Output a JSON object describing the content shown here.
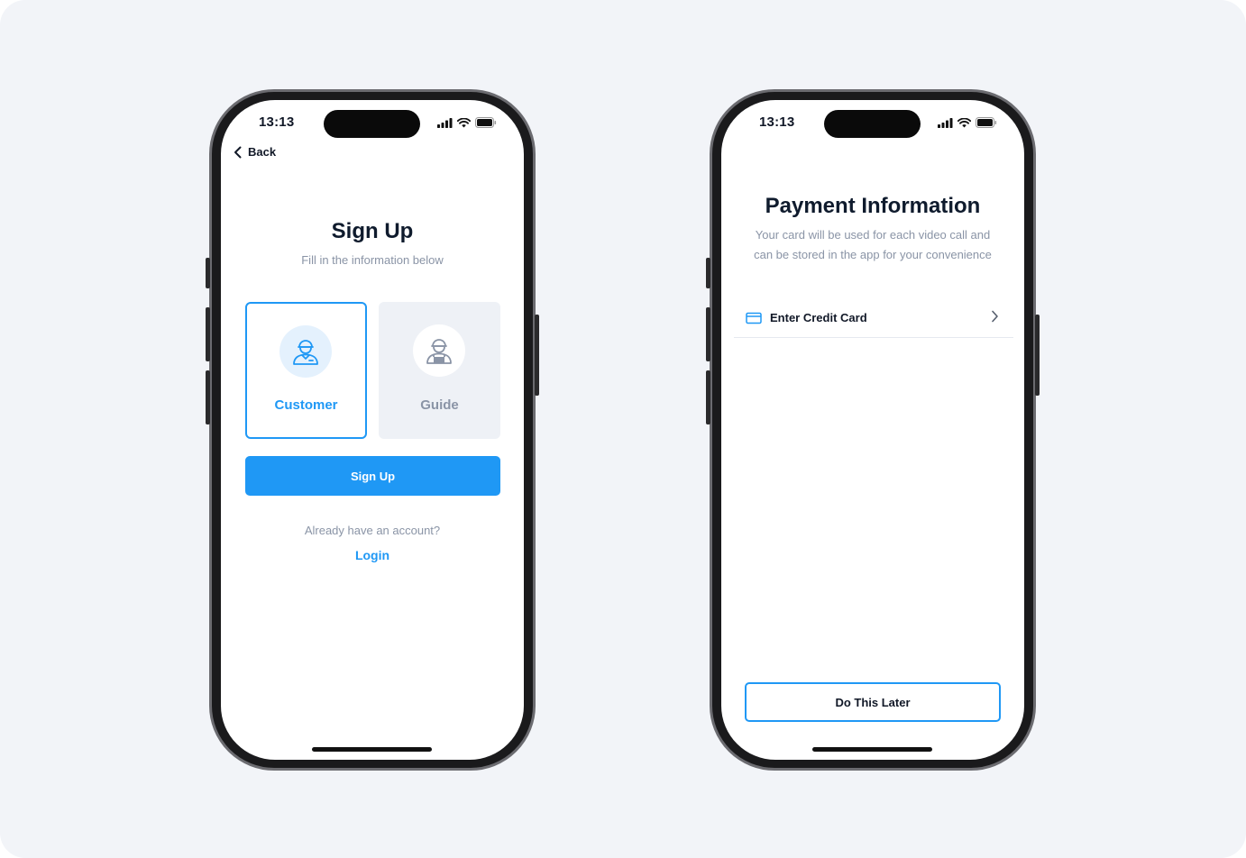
{
  "colors": {
    "background": "#f2f4f8",
    "accent": "#1f98f5",
    "text_dark": "#0f1b2d",
    "text_muted": "#8a94a6",
    "guide_card_bg": "#eef1f6"
  },
  "signup_screen": {
    "status_time": "13:13",
    "back_label": "Back",
    "title": "Sign Up",
    "subtitle": "Fill in the information below",
    "roles": [
      {
        "label": "Customer",
        "icon": "person-icon",
        "selected": true
      },
      {
        "label": "Guide",
        "icon": "worker-icon",
        "selected": false
      }
    ],
    "primary_button": "Sign Up",
    "already_text": "Already have an account?",
    "login_link": "Login"
  },
  "payment_screen": {
    "status_time": "13:13",
    "title": "Payment Information",
    "subtitle_line1": "Your card will be used for each video call and",
    "subtitle_line2": "can be stored in the app for your convenience",
    "card_row_label": "Enter Credit Card",
    "card_row_icon": "credit-card-icon",
    "later_button": "Do This Later"
  }
}
